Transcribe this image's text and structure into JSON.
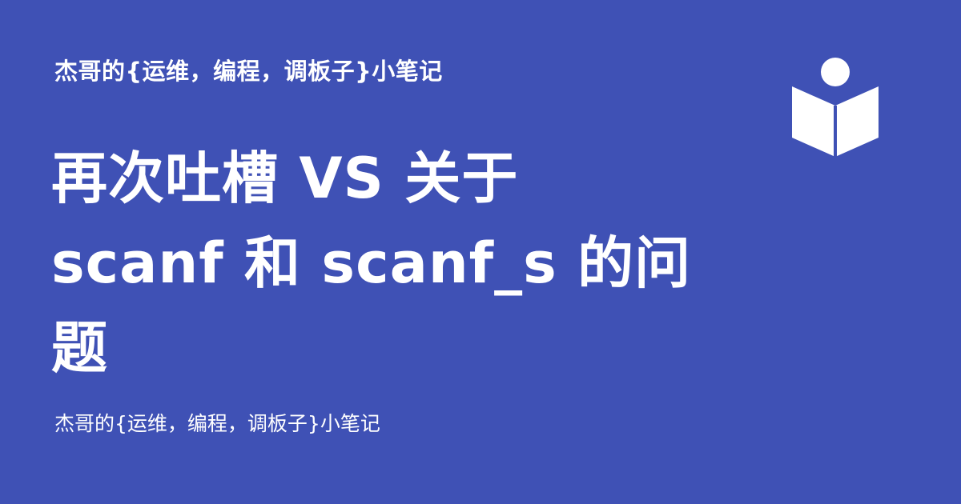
{
  "card": {
    "site_name": "杰哥的{运维，编程，调板子}小笔记",
    "title": "再次吐槽 VS 关于 scanf 和 scanf_s 的问题",
    "footer": "杰哥的{运维，编程，调板子}小笔记",
    "logo_icon": "reading-person-book-icon",
    "background_color": "#3f51b5",
    "text_color": "#ffffff"
  }
}
